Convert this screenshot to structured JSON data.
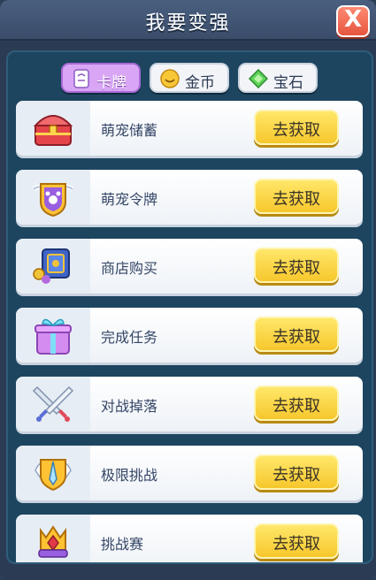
{
  "dialog": {
    "title": "我要变强",
    "close_label": "X"
  },
  "tabs": [
    {
      "label": "卡牌",
      "icon": "card-icon",
      "active": true
    },
    {
      "label": "金币",
      "icon": "gold-coin-icon",
      "active": false
    },
    {
      "label": "宝石",
      "icon": "gem-icon",
      "active": false
    }
  ],
  "items": [
    {
      "name": "萌宠储蓄",
      "icon": "treasure-chest-icon",
      "button": "去获取"
    },
    {
      "name": "萌宠令牌",
      "icon": "pet-badge-icon",
      "button": "去获取"
    },
    {
      "name": "商店购买",
      "icon": "shop-icon",
      "button": "去获取"
    },
    {
      "name": "完成任务",
      "icon": "gift-box-icon",
      "button": "去获取"
    },
    {
      "name": "对战掉落",
      "icon": "crossed-swords-icon",
      "button": "去获取"
    },
    {
      "name": "极限挑战",
      "icon": "winged-sword-icon",
      "button": "去获取"
    },
    {
      "name": "挑战赛",
      "icon": "crown-trophy-icon",
      "button": "去获取"
    }
  ],
  "colors": {
    "accent_tab": "#d9a6f5",
    "button_yellow": "#f6c72c",
    "panel_bg": "#1d4560"
  }
}
